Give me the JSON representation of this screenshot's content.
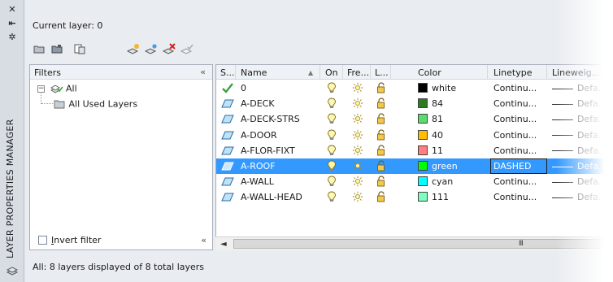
{
  "palette": {
    "title": "LAYER PROPERTIES MANAGER",
    "current_layer_label": "Current layer: 0",
    "status_text": "All: 8 layers displayed of 8 total layers"
  },
  "strip_icons": [
    "close-icon",
    "auto-hide-icon",
    "properties-icon",
    "layer-stack-icon"
  ],
  "toolbar": {
    "buttons": [
      "new-property-filter-icon",
      "new-group-filter-icon",
      "layer-states-manager-icon",
      "new-layer-icon",
      "new-layer-vp-frozen-icon",
      "delete-layer-icon",
      "set-current-icon"
    ]
  },
  "filters": {
    "header": "Filters",
    "collapse_glyph": "«",
    "tree": [
      {
        "label": "All",
        "expander": "⊟"
      },
      {
        "label": "All Used Layers"
      }
    ],
    "invert_filter": {
      "label": "Invert filter",
      "checked": false
    }
  },
  "grid": {
    "columns": [
      "S...",
      "Name",
      "On",
      "Fre...",
      "L...",
      "Color",
      "Linetype",
      "Lineweig..."
    ],
    "sort_glyph": "▲",
    "rows": [
      {
        "status": "current",
        "name": "0",
        "color_name": "white",
        "color_hex": "#000000",
        "linetype": "Continu...",
        "lineweight": "Defa...",
        "selected": false
      },
      {
        "status": "layer",
        "name": "A-DECK",
        "color_name": "84",
        "color_hex": "#2d7a1f",
        "linetype": "Continu...",
        "lineweight": "Defa...",
        "selected": false
      },
      {
        "status": "layer",
        "name": "A-DECK-STRS",
        "color_name": "81",
        "color_hex": "#5cdc6c",
        "linetype": "Continu...",
        "lineweight": "Defa...",
        "selected": false
      },
      {
        "status": "layer",
        "name": "A-DOOR",
        "color_name": "40",
        "color_hex": "#ffbf00",
        "linetype": "Continu...",
        "lineweight": "Defa...",
        "selected": false
      },
      {
        "status": "layer",
        "name": "A-FLOR-FIXT",
        "color_name": "11",
        "color_hex": "#ff7f7f",
        "linetype": "Continu...",
        "lineweight": "Defa...",
        "selected": false
      },
      {
        "status": "layer",
        "name": "A-ROOF",
        "color_name": "green",
        "color_hex": "#00ff00",
        "linetype": "DASHED",
        "lineweight": "Defa...",
        "selected": true
      },
      {
        "status": "layer",
        "name": "A-WALL",
        "color_name": "cyan",
        "color_hex": "#00ffff",
        "linetype": "Continu...",
        "lineweight": "Defa...",
        "selected": false
      },
      {
        "status": "layer",
        "name": "A-WALL-HEAD",
        "color_name": "111",
        "color_hex": "#7fffbf",
        "linetype": "Continu...",
        "lineweight": "Defa...",
        "selected": false
      }
    ]
  },
  "scrollbar": {
    "left_arrow": "◄",
    "grip": "III"
  },
  "colors": {
    "selection": "#3399ff",
    "panel_bg": "#e9ecf0"
  }
}
